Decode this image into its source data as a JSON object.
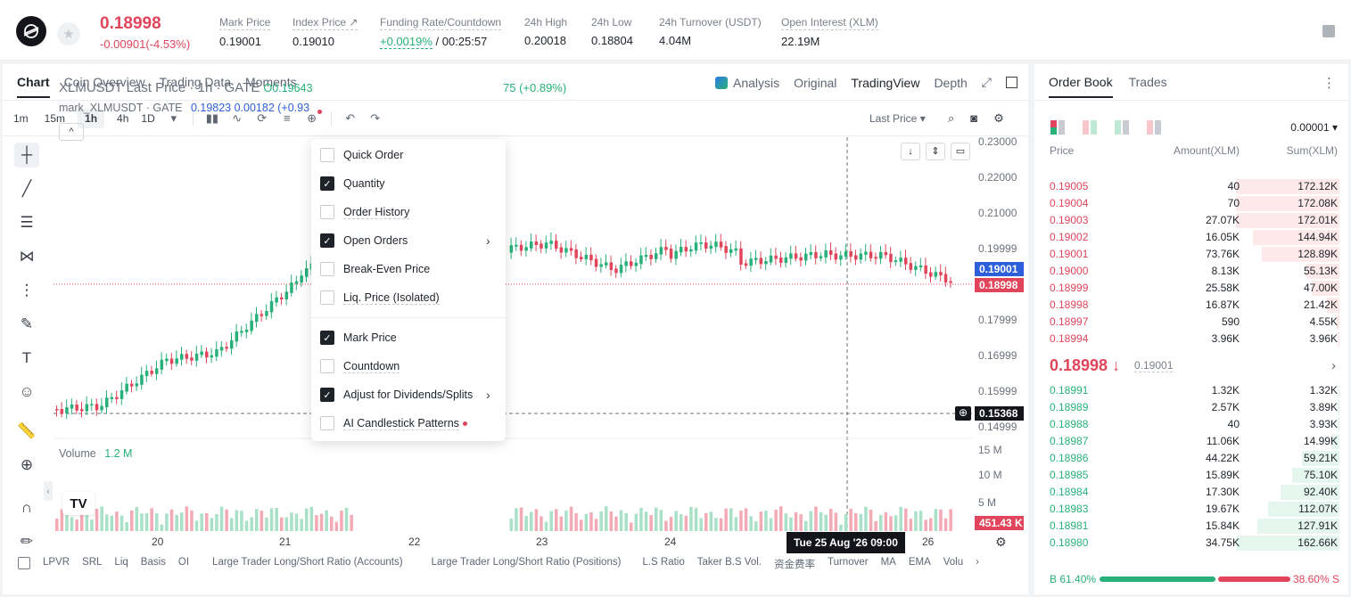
{
  "ticker": {
    "last_price": "0.18998",
    "change": "-0.00901(-4.53%)",
    "stats": [
      {
        "label": "Mark Price",
        "value": "0.19001"
      },
      {
        "label": "Index Price ↗",
        "value": "0.19010"
      },
      {
        "label": "Funding Rate/Countdown",
        "value_a": "+0.0019%",
        "value_b": " / 00:25:57"
      },
      {
        "label": "24h High",
        "value": "0.20018"
      },
      {
        "label": "24h Low",
        "value": "0.18804"
      },
      {
        "label": "24h Turnover (USDT)",
        "value": "4.04M"
      },
      {
        "label": "Open Interest (XLM)",
        "value": "22.19M"
      }
    ]
  },
  "chart_tabs": [
    "Chart",
    "Coin Overview",
    "Trading Data",
    "Moments"
  ],
  "chart_views": {
    "analysis": "Analysis",
    "original": "Original",
    "tradingview": "TradingView",
    "depth": "Depth"
  },
  "intervals": [
    "1m",
    "15m",
    "1h",
    "4h",
    "1D"
  ],
  "price_type": "Last Price ▾",
  "legend": {
    "symbol": "XLMUSDT Last Price · 1h · GATE",
    "open": "O0.19643",
    "change": "75 (+0.89%)",
    "mark_line_a": "mark_XLMUSDT · GATE",
    "mark_line_b": "0.19823  0.00182  (+0.93"
  },
  "y_axis": [
    "0.23000",
    "0.22000",
    "0.21000",
    "0.19999",
    "0.19001",
    "0.18998",
    "0.17999",
    "0.16999",
    "0.15999",
    "0.15368",
    "0.14999"
  ],
  "volume_axis": [
    "15 M",
    "10 M",
    "5 M",
    "451.43 K"
  ],
  "volume_label": "Volume",
  "volume_value": "1.2 M",
  "x_axis": [
    "20",
    "21",
    "22",
    "23",
    "24",
    "26"
  ],
  "crosshair_time": "Tue 25 Aug '26   09:00",
  "indicators": [
    "LPVR",
    "SRL",
    "Liq",
    "Basis",
    "OI",
    "Large Trader Long/Short Ratio (Accounts)",
    "Large Trader Long/Short Ratio (Positions)",
    "L.S Ratio",
    "Taker B.S Vol.",
    "资金费率",
    "Turnover",
    "MA",
    "EMA",
    "Volu"
  ],
  "menu": [
    {
      "label": "Quick Order",
      "checked": false
    },
    {
      "label": "Quantity",
      "checked": true
    },
    {
      "label": "Order History",
      "checked": false
    },
    {
      "label": "Open Orders",
      "checked": true
    },
    {
      "label": "Break-Even Price",
      "checked": false
    },
    {
      "label": "Liq. Price (Isolated)",
      "checked": false
    },
    {
      "label": "Mark Price",
      "checked": true
    },
    {
      "label": "Countdown",
      "checked": false
    },
    {
      "label": "Adjust for Dividends/Splits",
      "checked": true
    },
    {
      "label": "AI Candlestick Patterns",
      "checked": false
    }
  ],
  "orderbook": {
    "tabs": [
      "Order Book",
      "Trades"
    ],
    "precision": "0.00001 ▾",
    "headers": [
      "Price",
      "Amount(XLM)",
      "Sum(XLM)"
    ],
    "asks": [
      {
        "price": "0.19005",
        "amount": "40",
        "sum": "172.12K",
        "depth": 1.0
      },
      {
        "price": "0.19004",
        "amount": "70",
        "sum": "172.08K",
        "depth": 1.0
      },
      {
        "price": "0.19003",
        "amount": "27.07K",
        "sum": "172.01K",
        "depth": 1.0
      },
      {
        "price": "0.19002",
        "amount": "16.05K",
        "sum": "144.94K",
        "depth": 0.84
      },
      {
        "price": "0.19001",
        "amount": "73.76K",
        "sum": "128.89K",
        "depth": 0.75
      },
      {
        "price": "0.19000",
        "amount": "8.13K",
        "sum": "55.13K",
        "depth": 0.32
      },
      {
        "price": "0.18999",
        "amount": "25.58K",
        "sum": "47.00K",
        "depth": 0.27
      },
      {
        "price": "0.18998",
        "amount": "16.87K",
        "sum": "21.42K",
        "depth": 0.12
      },
      {
        "price": "0.18997",
        "amount": "590",
        "sum": "4.55K",
        "depth": 0.03
      },
      {
        "price": "0.18994",
        "amount": "3.96K",
        "sum": "3.96K",
        "depth": 0.02
      }
    ],
    "mid_price": "0.18998 ↓",
    "mid_mark": "0.19001",
    "bids": [
      {
        "price": "0.18991",
        "amount": "1.32K",
        "sum": "1.32K",
        "depth": 0.01
      },
      {
        "price": "0.18989",
        "amount": "2.57K",
        "sum": "3.89K",
        "depth": 0.02
      },
      {
        "price": "0.18988",
        "amount": "40",
        "sum": "3.93K",
        "depth": 0.02
      },
      {
        "price": "0.18987",
        "amount": "11.06K",
        "sum": "14.99K",
        "depth": 0.08
      },
      {
        "price": "0.18986",
        "amount": "44.22K",
        "sum": "59.21K",
        "depth": 0.36
      },
      {
        "price": "0.18985",
        "amount": "15.89K",
        "sum": "75.10K",
        "depth": 0.46
      },
      {
        "price": "0.18984",
        "amount": "17.30K",
        "sum": "92.40K",
        "depth": 0.57
      },
      {
        "price": "0.18983",
        "amount": "19.67K",
        "sum": "112.07K",
        "depth": 0.69
      },
      {
        "price": "0.18981",
        "amount": "15.84K",
        "sum": "127.91K",
        "depth": 0.79
      },
      {
        "price": "0.18980",
        "amount": "34.75K",
        "sum": "162.66K",
        "depth": 1.0
      }
    ],
    "buy_ratio": "B 61.40%",
    "sell_ratio": "38.60% S",
    "buy_fraction": 0.614
  },
  "colors": {
    "up": "#27b07a",
    "down": "#e0455b",
    "accent": "#2c5fd9"
  }
}
